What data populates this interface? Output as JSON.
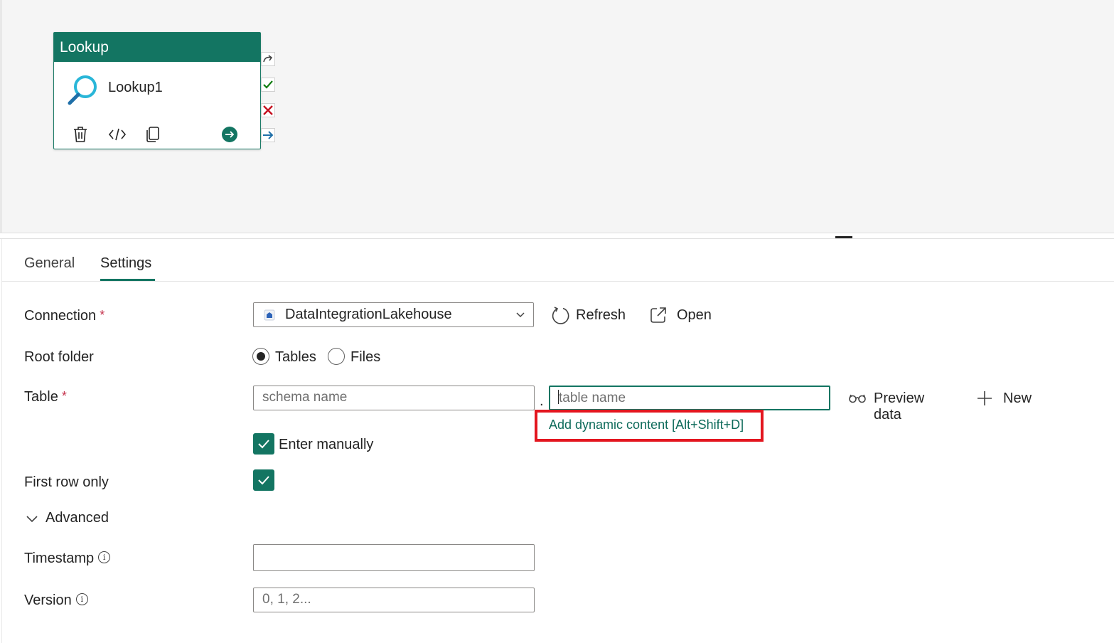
{
  "canvas": {
    "activity": {
      "type_label": "Lookup",
      "name": "Lookup1"
    }
  },
  "tabs": [
    {
      "label": "General",
      "active": false
    },
    {
      "label": "Settings",
      "active": true
    }
  ],
  "settings": {
    "connection": {
      "label": "Connection",
      "required_mark": "*",
      "value": "DataIntegrationLakehouse",
      "refresh_label": "Refresh",
      "open_label": "Open"
    },
    "root_folder": {
      "label": "Root folder",
      "options": [
        "Tables",
        "Files"
      ],
      "selected": "Tables"
    },
    "table": {
      "label": "Table",
      "required_mark": "*",
      "schema_placeholder": "schema name",
      "separator": ".",
      "table_placeholder": "table name",
      "dynamic_content_link": "Add dynamic content [Alt+Shift+D]",
      "preview_label": "Preview data",
      "new_label": "New",
      "enter_manually_label": "Enter manually",
      "enter_manually_checked": true
    },
    "first_row_only": {
      "label": "First row only",
      "checked": true
    },
    "advanced": {
      "label": "Advanced",
      "expanded": true
    },
    "timestamp": {
      "label": "Timestamp",
      "value": ""
    },
    "version": {
      "label": "Version",
      "placeholder": "0, 1, 2..."
    }
  },
  "colors": {
    "accent": "#137562",
    "highlight": "#e3161f"
  }
}
